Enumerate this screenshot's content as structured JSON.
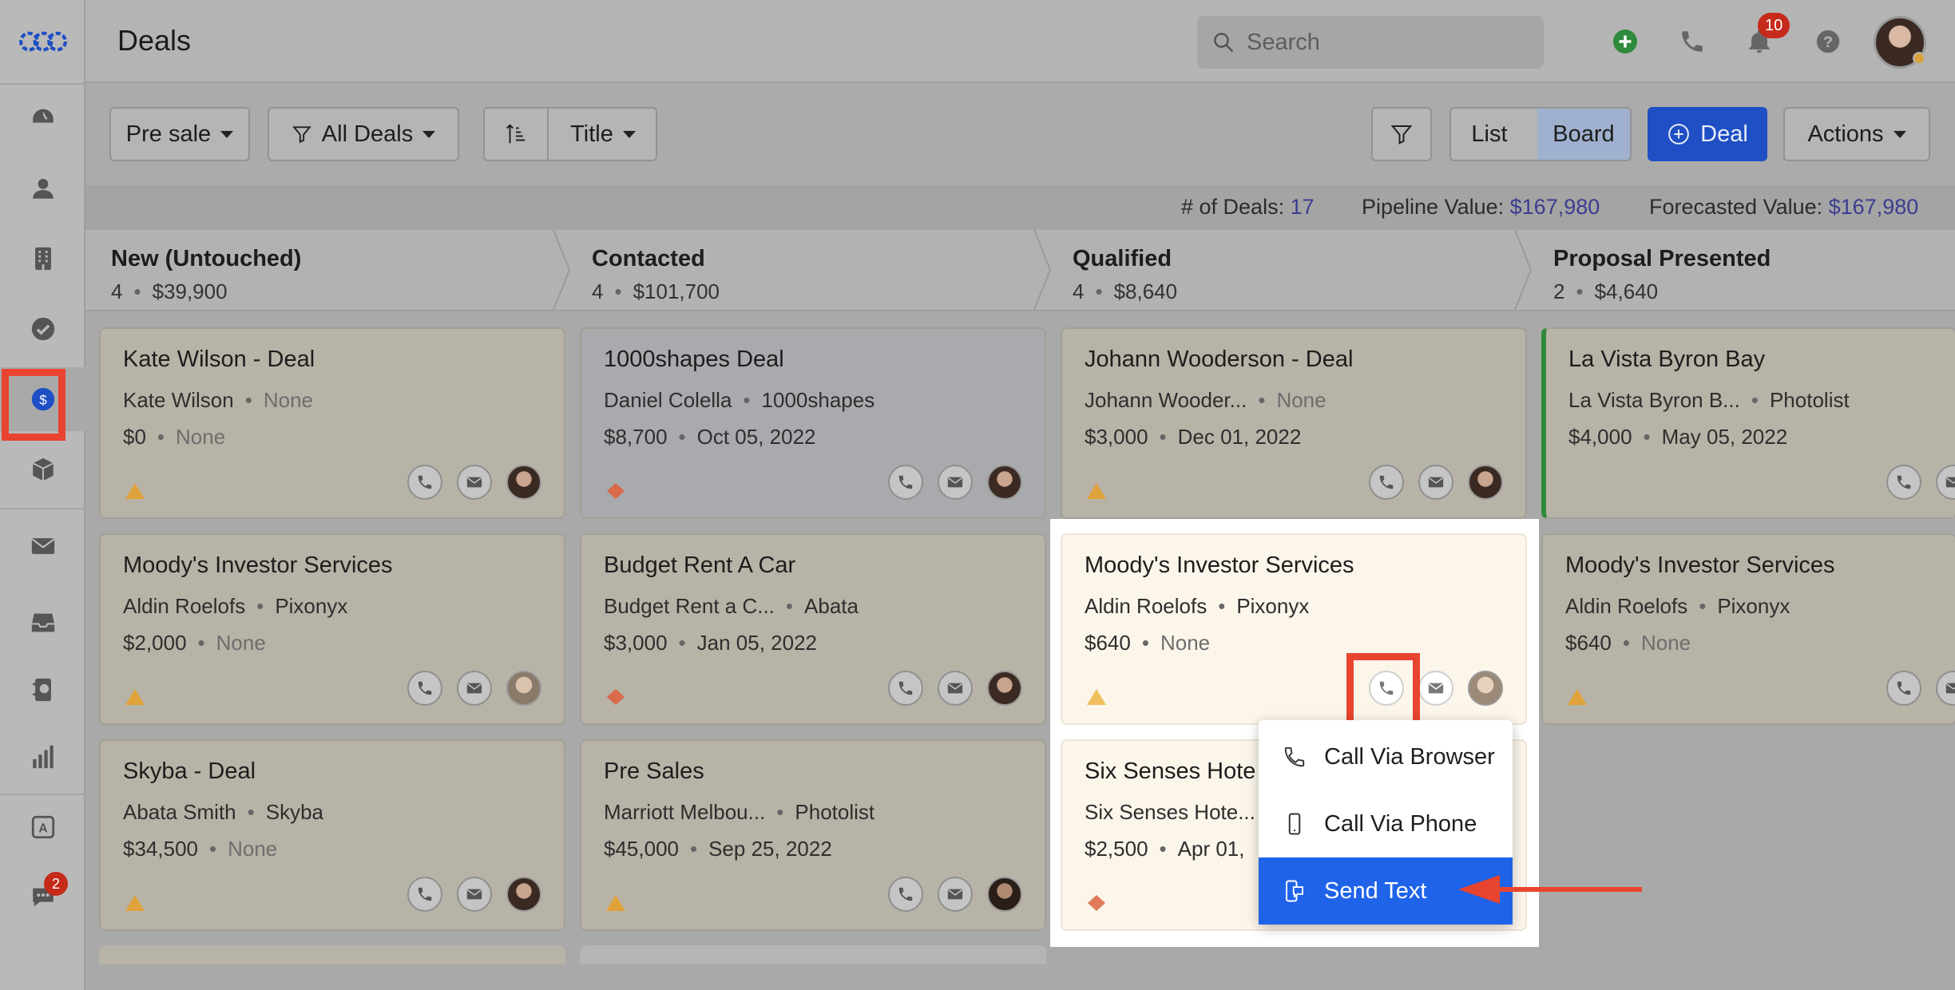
{
  "app": {
    "title": "Deals"
  },
  "header": {
    "search_placeholder": "Search",
    "notifications_count": "10"
  },
  "sidebar": {
    "chat_badge": "2",
    "items": [
      {
        "icon": "logo-icon"
      },
      {
        "icon": "dashboard-icon"
      },
      {
        "icon": "contacts-icon"
      },
      {
        "icon": "companies-icon"
      },
      {
        "icon": "tasks-icon"
      },
      {
        "icon": "deals-icon",
        "active": true
      },
      {
        "icon": "products-icon"
      },
      {
        "icon": "email-icon"
      },
      {
        "icon": "inbox-icon"
      },
      {
        "icon": "phone-book-icon"
      },
      {
        "icon": "reports-icon"
      },
      {
        "icon": "automation-icon"
      },
      {
        "icon": "chat-icon"
      }
    ]
  },
  "toolbar": {
    "pipeline": "Pre sale",
    "filter": "All Deals",
    "sort_field": "Title",
    "view_list": "List",
    "view_board": "Board",
    "add_deal": "Deal",
    "actions": "Actions"
  },
  "stats": {
    "deals_label": "# of Deals:",
    "deals_value": "17",
    "pipeline_label": "Pipeline Value:",
    "pipeline_value": "$167,980",
    "forecast_label": "Forecasted Value:",
    "forecast_value": "$167,980"
  },
  "stages": [
    {
      "name": "New (Untouched)",
      "count": "4",
      "value": "$39,900"
    },
    {
      "name": "Contacted",
      "count": "4",
      "value": "$101,700"
    },
    {
      "name": "Qualified",
      "count": "4",
      "value": "$8,640"
    },
    {
      "name": "Proposal Presented",
      "count": "2",
      "value": "$4,640"
    }
  ],
  "cards": {
    "c1": {
      "title": "Kate Wilson - Deal",
      "contact": "Kate Wilson",
      "company": "None",
      "amount": "$0",
      "date": "None"
    },
    "c2": {
      "title": "Moody's Investor Services",
      "contact": "Aldin Roelofs",
      "company": "Pixonyx",
      "amount": "$2,000",
      "date": "None"
    },
    "c3": {
      "title": "Skyba - Deal",
      "contact": "Abata Smith",
      "company": "Skyba",
      "amount": "$34,500",
      "date": "None"
    },
    "c4": {
      "title": "1000shapes Deal",
      "contact": "Daniel Colella",
      "company": "1000shapes",
      "amount": "$8,700",
      "date": "Oct 05, 2022"
    },
    "c5": {
      "title": "Budget Rent A Car",
      "contact": "Budget Rent a C...",
      "company": "Abata",
      "amount": "$3,000",
      "date": "Jan 05, 2022"
    },
    "c6": {
      "title": "Pre Sales",
      "contact": "Marriott Melbou...",
      "company": "Photolist",
      "amount": "$45,000",
      "date": "Sep 25, 2022"
    },
    "c7": {
      "title": "Johann Wooderson - Deal",
      "contact": "Johann Wooder...",
      "company": "None",
      "amount": "$3,000",
      "date": "Dec 01, 2022"
    },
    "c8": {
      "title": "Moody's Investor Services",
      "contact": "Aldin Roelofs",
      "company": "Pixonyx",
      "amount": "$640",
      "date": "None"
    },
    "c9": {
      "title": "Six Senses Hote",
      "contact": "Six Senses Hote...",
      "company": "",
      "amount": "$2,500",
      "date": "Apr 01,"
    },
    "c10": {
      "title": "La Vista Byron Bay",
      "contact": "La Vista Byron B...",
      "company": "Photolist",
      "amount": "$4,000",
      "date": "May 05, 2022"
    },
    "c11": {
      "title": "Moody's Investor Services",
      "contact": "Aldin Roelofs",
      "company": "Pixonyx",
      "amount": "$640",
      "date": "None"
    }
  },
  "call_menu": {
    "items": [
      {
        "label": "Call Via Browser",
        "icon": "phone-icon"
      },
      {
        "label": "Call Via Phone",
        "icon": "mobile-icon"
      },
      {
        "label": "Send Text",
        "icon": "text-message-icon",
        "active": true
      }
    ]
  },
  "colors": {
    "accent": "#1f63e8",
    "deal_button": "#1f4fc4",
    "highlight": "#e8442f",
    "priority_low": "#e0a23a",
    "priority_high": "#d96a4a",
    "stat_value": "#3b3d8f"
  }
}
